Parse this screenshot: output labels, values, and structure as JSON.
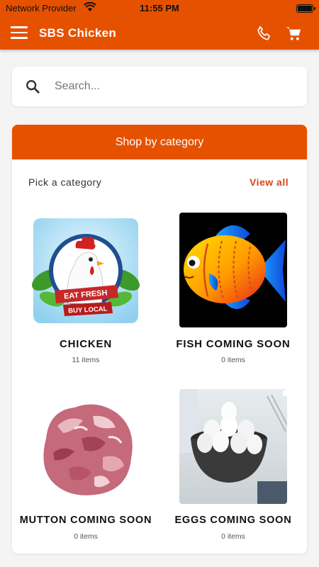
{
  "status_bar": {
    "carrier": "Network Provider",
    "time": "11:55 PM"
  },
  "app_bar": {
    "title": "SBS Chicken",
    "menu_icon": "hamburger-menu-icon",
    "phone_icon": "phone-icon",
    "cart_icon": "cart-icon"
  },
  "search": {
    "placeholder": "Search...",
    "value": ""
  },
  "category_card": {
    "header": "Shop by category",
    "pick_label": "Pick a category",
    "view_all": "View all",
    "categories": [
      {
        "name": "CHICKEN",
        "count": "11 items"
      },
      {
        "name": "FISH COMING SOON",
        "count": "0 items"
      },
      {
        "name": "MUTTON COMING SOON",
        "count": "0 items"
      },
      {
        "name": "EGGS COMING SOON",
        "count": "0 items"
      }
    ]
  },
  "colors": {
    "primary": "#e65100",
    "accent_text": "#d84315",
    "background": "#f4f4f4"
  }
}
